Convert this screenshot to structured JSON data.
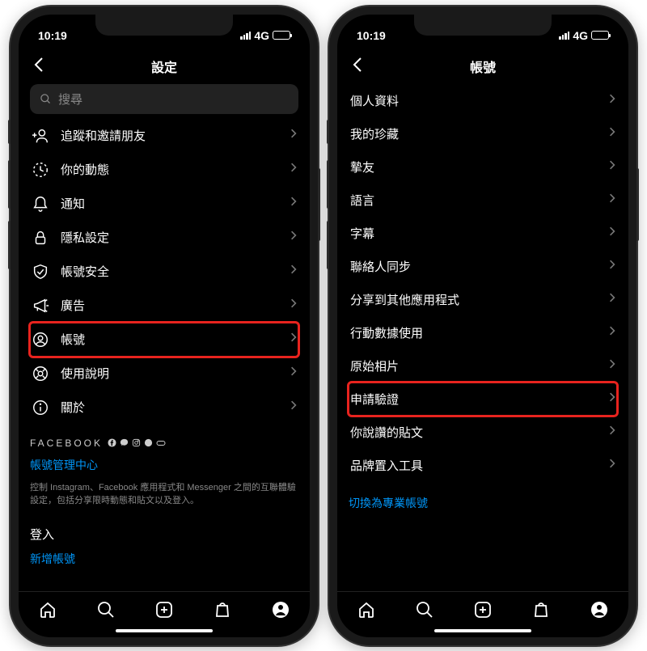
{
  "status": {
    "time": "10:19",
    "network": "4G"
  },
  "left": {
    "title": "設定",
    "search_placeholder": "搜尋",
    "items": {
      "follow": "追蹤和邀請朋友",
      "activity": "你的動態",
      "notifications": "通知",
      "privacy": "隱私設定",
      "security": "帳號安全",
      "ads": "廣告",
      "account": "帳號",
      "help": "使用說明",
      "about": "關於"
    },
    "facebook_label": "FACEBOOK",
    "account_center": "帳號管理中心",
    "description": "控制 Instagram、Facebook 應用程式和 Messenger 之間的互聯體驗設定，包括分享限時動態和貼文以及登入。",
    "login_label": "登入",
    "add_account": "新增帳號"
  },
  "right": {
    "title": "帳號",
    "items": {
      "personal_info": "個人資料",
      "saved": "我的珍藏",
      "close_friends": "摯友",
      "language": "語言",
      "captions": "字幕",
      "contacts_sync": "聯絡人同步",
      "share_other_apps": "分享到其他應用程式",
      "mobile_data": "行動數據使用",
      "original_photos": "原始相片",
      "request_verification": "申請驗證",
      "posts_liked": "你說讚的貼文",
      "branded_content": "品牌置入工具"
    },
    "switch_professional": "切換為專業帳號"
  }
}
